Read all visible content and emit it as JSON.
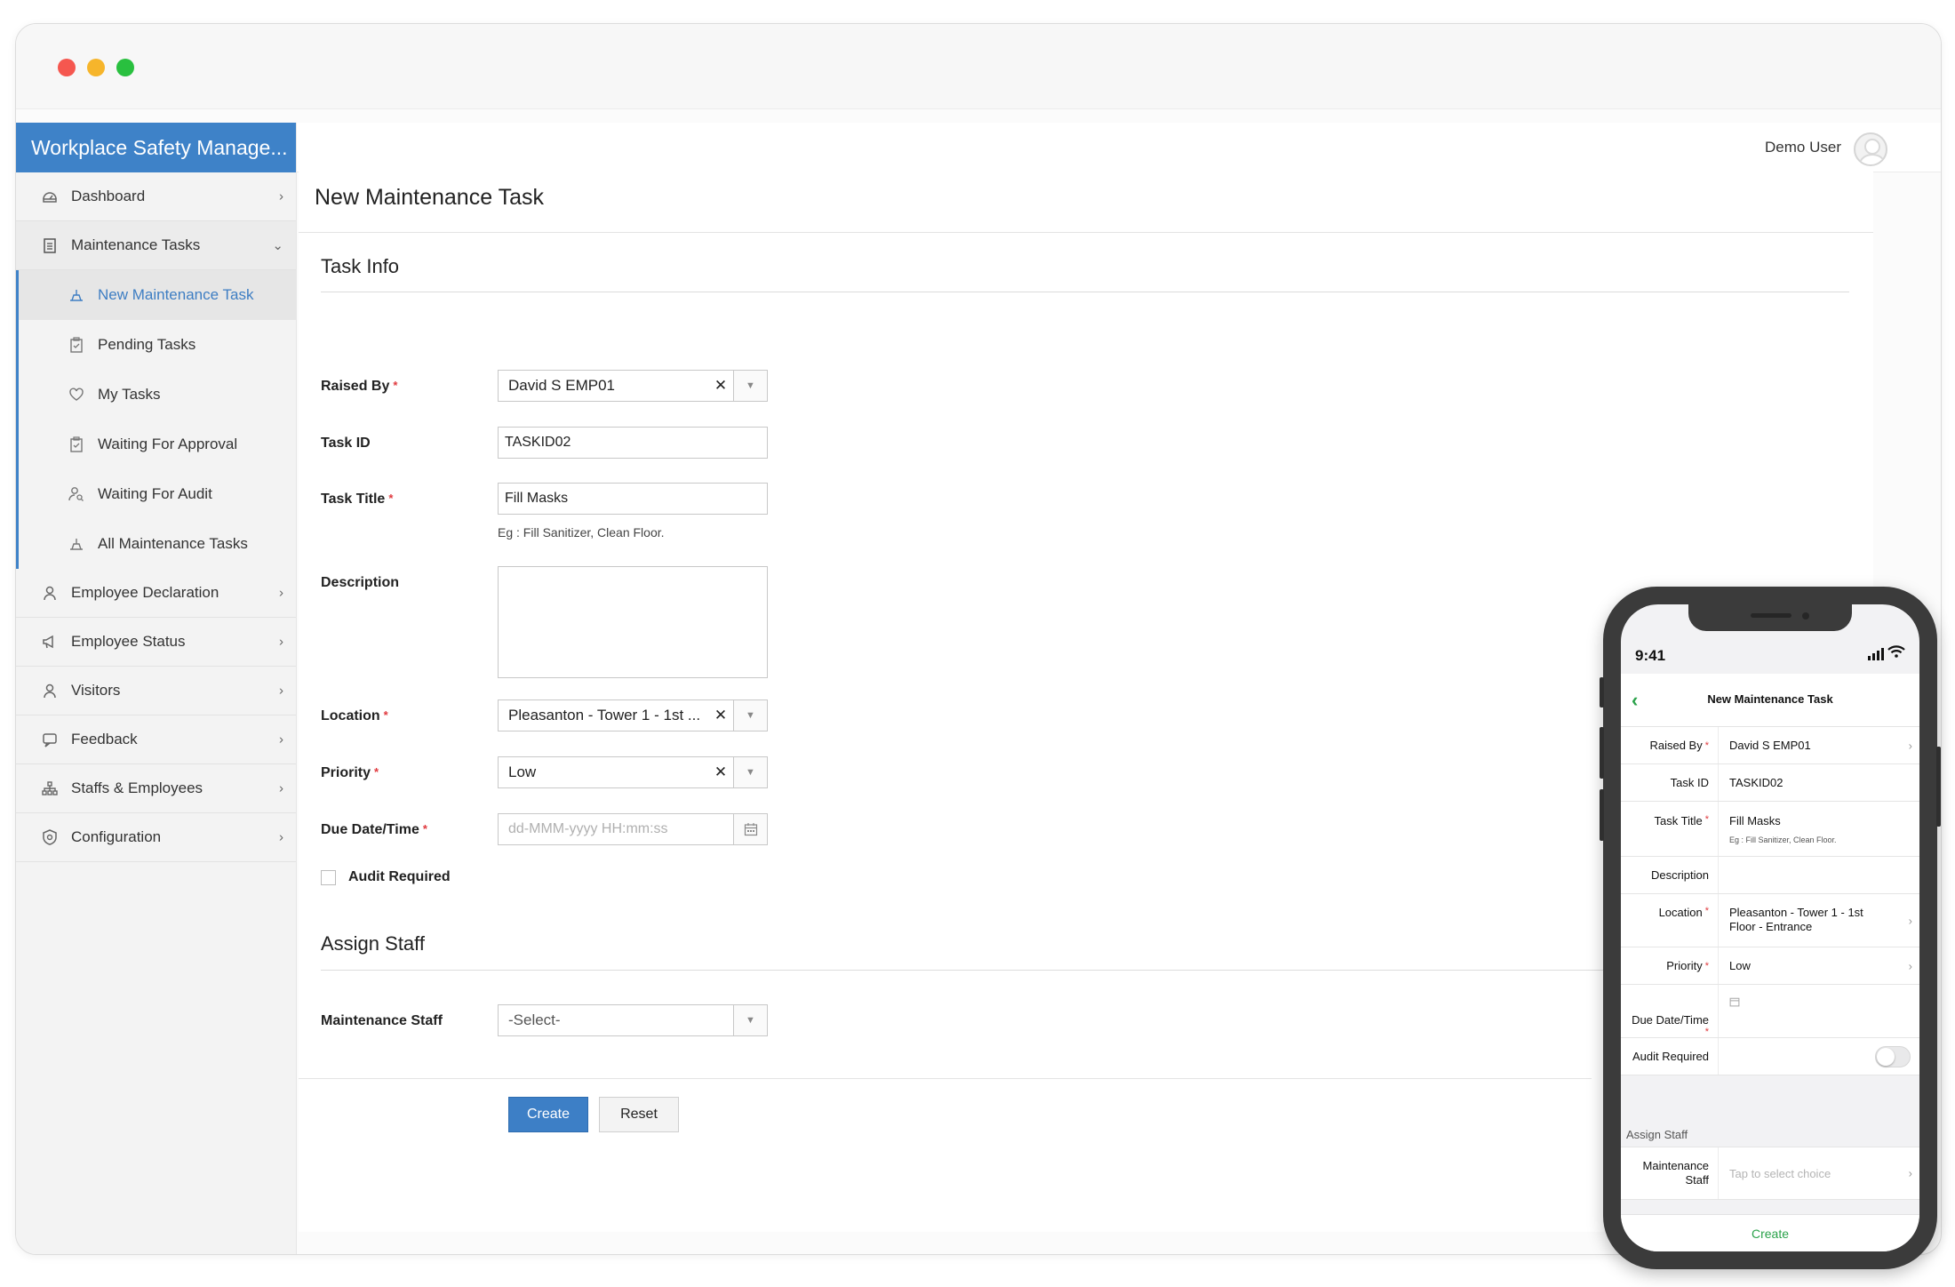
{
  "app": {
    "brand": "Workplace Safety Manage...",
    "user": "Demo User"
  },
  "sidebar": {
    "items": [
      {
        "label": "Dashboard",
        "icon": "dashboard-icon"
      },
      {
        "label": "Maintenance Tasks",
        "icon": "clipboard-icon",
        "expanded": true
      },
      {
        "label": "Employee Declaration",
        "icon": "person-badge-icon"
      },
      {
        "label": "Employee Status",
        "icon": "megaphone-icon"
      },
      {
        "label": "Visitors",
        "icon": "person-icon"
      },
      {
        "label": "Feedback",
        "icon": "feedback-icon"
      },
      {
        "label": "Staffs & Employees",
        "icon": "org-chart-icon"
      },
      {
        "label": "Configuration",
        "icon": "gear-shield-icon"
      }
    ],
    "sub_items": [
      {
        "label": "New Maintenance Task",
        "icon": "cleaning-icon",
        "active": true
      },
      {
        "label": "Pending Tasks",
        "icon": "clipboard-check-icon"
      },
      {
        "label": "My Tasks",
        "icon": "heart-icon"
      },
      {
        "label": "Waiting For Approval",
        "icon": "clipboard-check-icon"
      },
      {
        "label": "Waiting For Audit",
        "icon": "user-search-icon"
      },
      {
        "label": "All Maintenance Tasks",
        "icon": "cleaning-icon"
      }
    ]
  },
  "form": {
    "title": "New Maintenance Task",
    "section_task_info": "Task Info",
    "section_assign_staff": "Assign Staff",
    "raised_by": {
      "label": "Raised By",
      "value": "David S EMP01"
    },
    "task_id": {
      "label": "Task ID",
      "value": "TASKID02"
    },
    "task_title": {
      "label": "Task Title",
      "value": "Fill Masks",
      "hint": "Eg : Fill Sanitizer, Clean Floor."
    },
    "description": {
      "label": "Description",
      "value": ""
    },
    "location": {
      "label": "Location",
      "value": "Pleasanton - Tower 1 - 1st ..."
    },
    "priority": {
      "label": "Priority",
      "value": "Low"
    },
    "due_date": {
      "label": "Due Date/Time",
      "placeholder": "dd-MMM-yyyy HH:mm:ss"
    },
    "audit_required": {
      "label": "Audit Required",
      "checked": false
    },
    "maintenance_staff": {
      "label": "Maintenance Staff",
      "value": "-Select-"
    },
    "create_label": "Create",
    "reset_label": "Reset"
  },
  "mobile": {
    "time": "9:41",
    "title": "New Maintenance Task",
    "raised_by": {
      "label": "Raised By",
      "value": "David S EMP01"
    },
    "task_id": {
      "label": "Task ID",
      "value": "TASKID02"
    },
    "task_title": {
      "label": "Task Title",
      "value": "Fill Masks",
      "hint": "Eg : Fill Sanitizer, Clean Floor."
    },
    "description": {
      "label": "Description"
    },
    "location": {
      "label": "Location",
      "value_line1": "Pleasanton - Tower 1 - 1st",
      "value_line2": "Floor - Entrance"
    },
    "priority": {
      "label": "Priority",
      "value": "Low"
    },
    "due_date": {
      "label": "Due Date/Time"
    },
    "audit_required": {
      "label": "Audit Required",
      "on": false
    },
    "section_assign_staff": "Assign Staff",
    "maintenance_staff": {
      "label_line1": "Maintenance",
      "label_line2": "Staff",
      "placeholder": "Tap to select choice"
    },
    "create_label": "Create"
  },
  "colors": {
    "brand": "#3e82c8",
    "active_text": "#3e7ec3",
    "required": "#e0393e",
    "mobile_accent": "#2aa24a"
  }
}
